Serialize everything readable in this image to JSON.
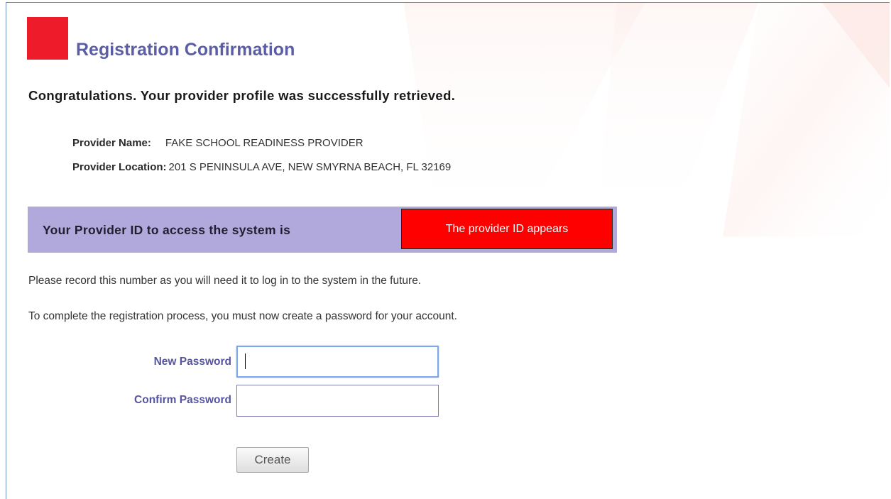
{
  "header": {
    "title": "Registration Confirmation",
    "brand_color": "#ee1c2b",
    "title_color": "#5b5ea6"
  },
  "confirmation": {
    "message": "Congratulations. Your provider profile was successfully retrieved."
  },
  "provider": {
    "name_label": "Provider Name:",
    "name_value": "FAKE SCHOOL READINESS PROVIDER",
    "location_label": "Provider Location:",
    "location_value": "201 S PENINSULA AVE, NEW SMYRNA BEACH, FL 32169"
  },
  "provider_id": {
    "label": "Your Provider ID to access the system is",
    "value": "The provider ID appears",
    "band_color": "#b1a9dc",
    "value_box_color": "#fe0000"
  },
  "instructions": {
    "record_note": "Please record this number as you will need it to log in to the system in the future.",
    "password_note": "To complete the registration process, you must now create a password for your account."
  },
  "form": {
    "new_password_label": "New Password",
    "new_password_value": "",
    "confirm_password_label": "Confirm Password",
    "confirm_password_value": "",
    "create_button_label": "Create"
  }
}
